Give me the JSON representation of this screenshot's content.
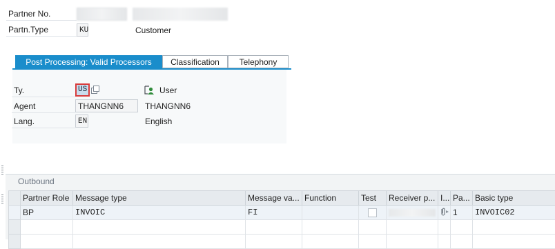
{
  "header": {
    "partner_no_label": "Partner No.",
    "partn_type_label": "Partn.Type",
    "partn_type_value": "KU",
    "partn_type_desc": "Customer"
  },
  "tabs": [
    {
      "label": "Post Processing: Valid Processors",
      "active": true
    },
    {
      "label": "Classification",
      "active": false
    },
    {
      "label": "Telephony",
      "active": false
    }
  ],
  "processors": {
    "ty_label": "Ty.",
    "ty_value": "US",
    "ty_desc": "User",
    "agent_label": "Agent",
    "agent_value": "THANGNN6",
    "agent_desc": "THANGNN6",
    "lang_label": "Lang.",
    "lang_value": "EN",
    "lang_desc": "English"
  },
  "outbound": {
    "title": "Outbound",
    "columns": [
      "Partner Role",
      "Message type",
      "Message va...",
      "Function",
      "Test",
      "Receiver p...",
      "I...",
      "Pa...",
      "Basic type"
    ],
    "rows": [
      {
        "partner_role": "BP",
        "message_type": "INVOIC",
        "message_variant": "FI",
        "function": "",
        "test": false,
        "receiver_port": "",
        "pa": "1",
        "basic_type": "INVOIC02"
      }
    ]
  },
  "icons": {
    "user": "user-icon",
    "copy": "copy-icon",
    "attachment": "paperclip-icon"
  },
  "colors": {
    "accent": "#1a8dcb",
    "user_icon": "#2e8b3a"
  }
}
